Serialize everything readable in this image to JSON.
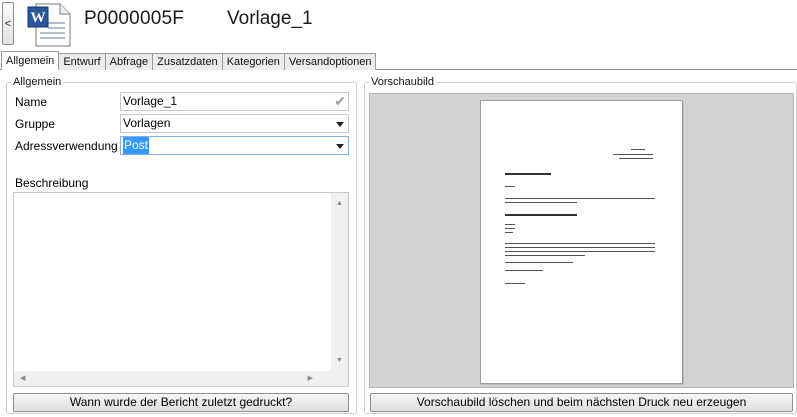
{
  "header": {
    "back_label": "<",
    "doc_icon_letter": "W",
    "record_id": "P0000005F",
    "record_name": "Vorlage_1"
  },
  "tabs": [
    {
      "label": "Allgemein",
      "active": true
    },
    {
      "label": "Entwurf"
    },
    {
      "label": "Abfrage"
    },
    {
      "label": "Zusatzdaten"
    },
    {
      "label": "Kategorien"
    },
    {
      "label": "Versandoptionen"
    }
  ],
  "general": {
    "legend": "Allgemein",
    "name_label": "Name",
    "name_value": "Vorlage_1",
    "group_label": "Gruppe",
    "group_value": "Vorlagen",
    "address_label": "Adressverwendung",
    "address_value": "Post",
    "description_label": "Beschreibung",
    "description_value": "",
    "last_printed_button": "Wann wurde der Bericht zuletzt gedruckt?"
  },
  "preview": {
    "legend": "Vorschaubild",
    "regenerate_button": "Vorschaubild löschen und beim nächsten Druck neu erzeugen"
  },
  "colors": {
    "selection": "#3399ff",
    "preview_bg": "#d3d3d3",
    "word_blue": "#2b579a"
  }
}
